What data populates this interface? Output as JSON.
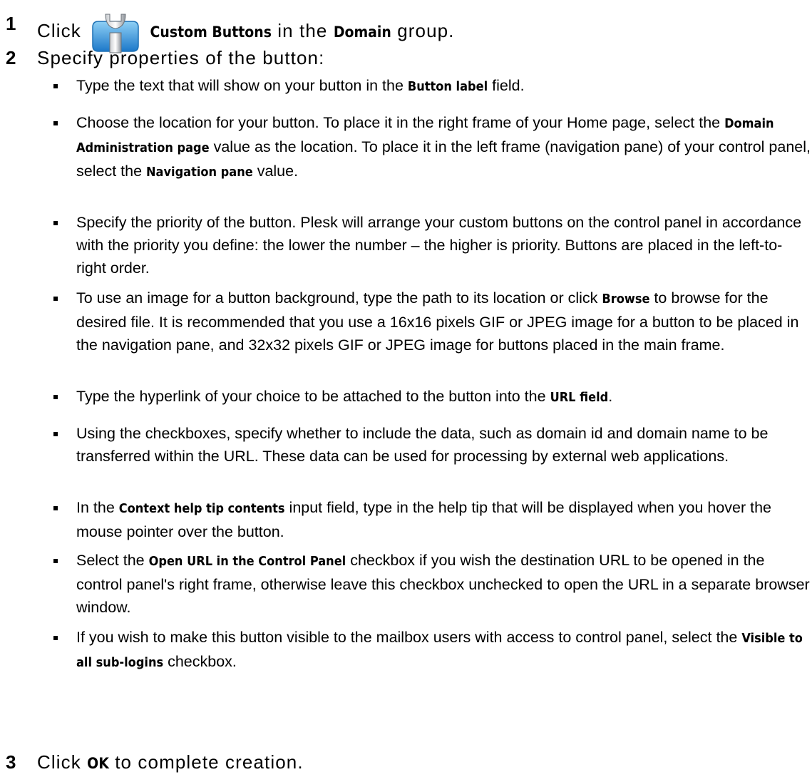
{
  "steps": [
    {
      "num": "1",
      "pre": "Click",
      "bold1": "Custom Buttons",
      "mid": "in the",
      "bold2": "Domain",
      "post": "group.",
      "icon": "custom-buttons-icon"
    },
    {
      "num": "2",
      "text": "Specify properties of the button:"
    },
    {
      "num": "3",
      "pre": "Click",
      "bold": "OK",
      "post": "to complete creation."
    }
  ],
  "bullets": [
    {
      "a": "Type the text that will show on your button in the ",
      "b": "Button label",
      "c": " field."
    },
    {
      "a": "Choose the location for your button. To place it in the right frame of your Home page, select the ",
      "b": "Domain Administration page",
      "c": " value as the location. To place it in the left frame (navigation pane) of your control panel, select the ",
      "d": "Navigation pane",
      "e": " value."
    },
    {
      "a": "Specify the priority of the button. Plesk will arrange your custom buttons on the control panel in accordance with the priority you define: the lower the number – the higher is priority. Buttons are placed in the left-to-right order."
    },
    {
      "a": "To use an image for a button background, type the path to its location or click ",
      "b": "Browse",
      "c": " to browse for the desired file. It is recommended that you use a 16x16 pixels GIF or JPEG image for a button to be placed in the navigation pane, and 32x32 pixels GIF or JPEG image for buttons placed in the main frame."
    },
    {
      "a": "Type the hyperlink of your choice to be attached to the button into the ",
      "b": "URL field",
      "c": "."
    },
    {
      "a": "Using the checkboxes, specify whether to include the data, such as domain id and domain name to be transferred within the URL. These data can be used for processing by external web applications."
    },
    {
      "a": "In the ",
      "b": "Context help tip contents",
      "c": " input field, type in the help tip that will be displayed when you hover the mouse pointer over the button."
    },
    {
      "a": "Select the ",
      "b": "Open URL in the Control Panel",
      "c": " checkbox if you wish the destination URL to be opened in the control panel's right frame, otherwise leave this checkbox unchecked to open the URL in a separate browser window."
    },
    {
      "a": "If you wish to make this button visible to the mailbox users with access to control panel, select the ",
      "b": "Visible to all sub-logins",
      "c": " checkbox."
    }
  ]
}
